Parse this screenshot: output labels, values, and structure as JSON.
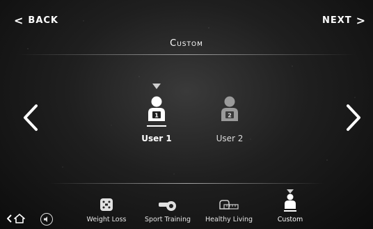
{
  "nav": {
    "back_label": "BACK",
    "next_label": "NEXT"
  },
  "header": {
    "title": "Custom"
  },
  "users": [
    {
      "label": "User 1",
      "number": "1",
      "selected": true
    },
    {
      "label": "User 2",
      "number": "2",
      "selected": false
    }
  ],
  "tabs": [
    {
      "label": "Weight Loss",
      "icon": "scale-icon"
    },
    {
      "label": "Sport Training",
      "icon": "whistle-icon"
    },
    {
      "label": "Healthy Living",
      "icon": "tape-measure-icon"
    },
    {
      "label": "Custom",
      "icon": "user-icon",
      "active": true
    }
  ],
  "colors": {
    "background": "#1f1f1f",
    "text": "#ffffff",
    "inactive_avatar": "#9a9a9a"
  }
}
